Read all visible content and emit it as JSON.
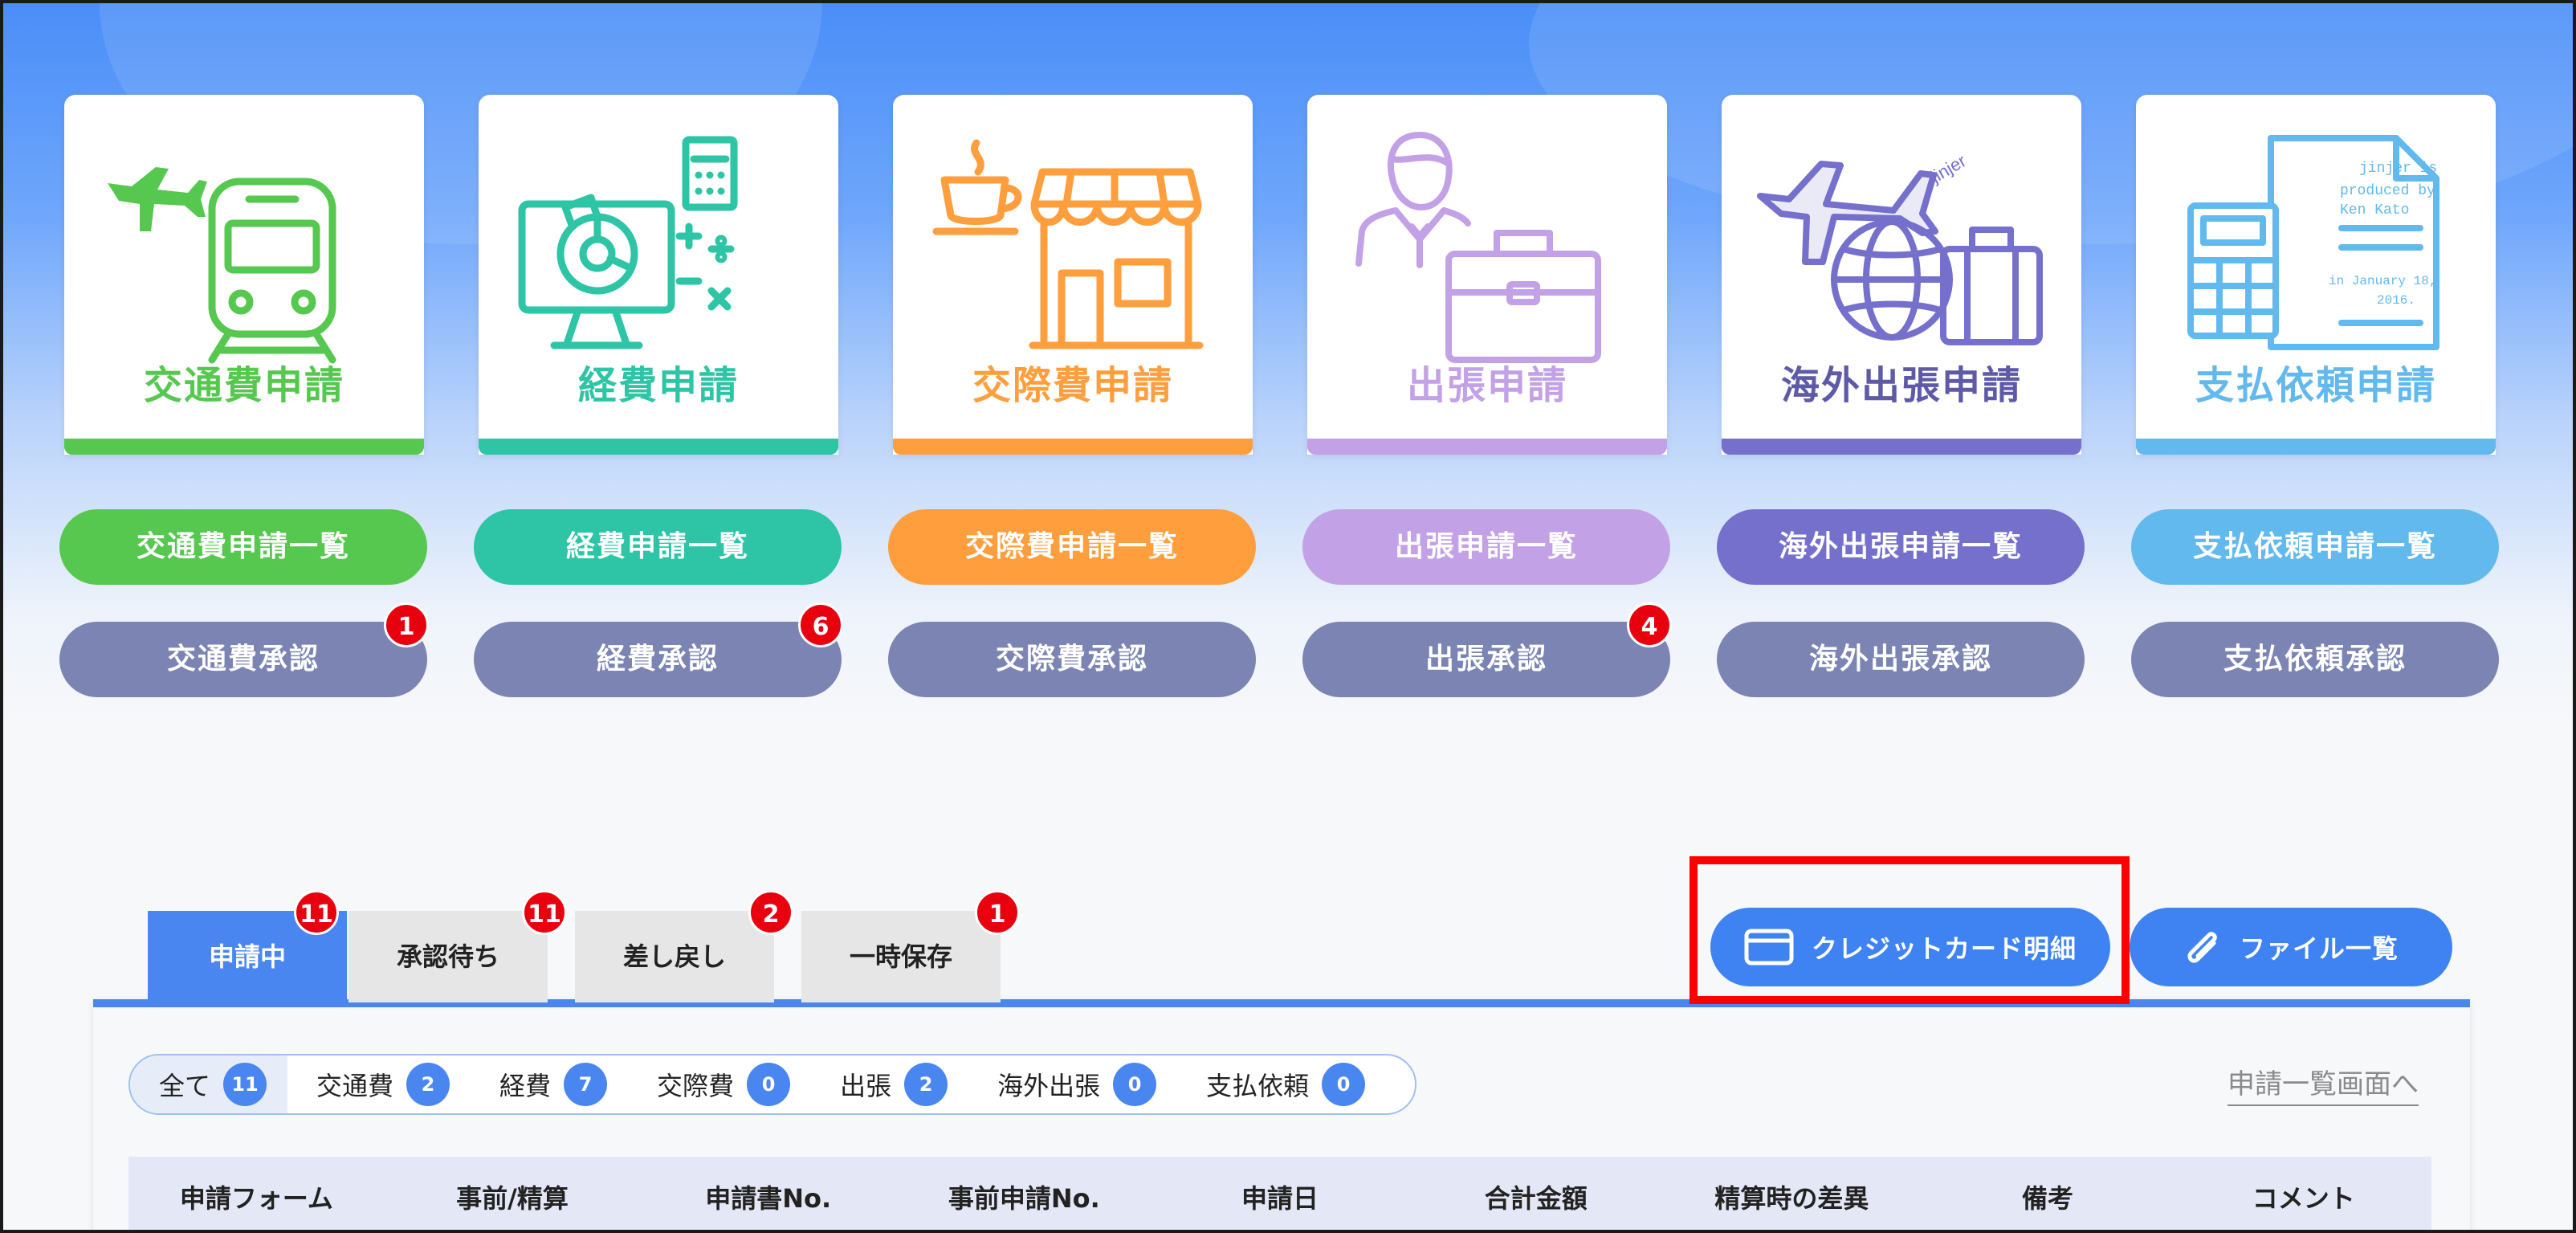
{
  "colors": {
    "transport": "#56c84f",
    "expense": "#2ec4a6",
    "entertainment": "#ff9e3d",
    "trip": "#c3a1e6",
    "overseas": "#7570cc",
    "payment": "#62b9ee",
    "approve": "#7b84b2",
    "accent": "#4a86f0",
    "badge": "#e8000f",
    "highlight": "#ff0000"
  },
  "tiles": [
    {
      "label": "交通費申請",
      "icon": "train-plane-icon"
    },
    {
      "label": "経費申請",
      "icon": "monitor-calculator-icon"
    },
    {
      "label": "交際費申請",
      "icon": "coffee-shop-icon"
    },
    {
      "label": "出張申請",
      "icon": "businessman-briefcase-icon"
    },
    {
      "label": "海外出張申請",
      "icon": "plane-globe-suitcase-icon"
    },
    {
      "label": "支払依頼申請",
      "icon": "calculator-document-icon"
    }
  ],
  "list_buttons": [
    "交通費申請一覧",
    "経費申請一覧",
    "交際費申請一覧",
    "出張申請一覧",
    "海外出張申請一覧",
    "支払依頼申請一覧"
  ],
  "approve_buttons": [
    {
      "label": "交通費承認",
      "badge": "1"
    },
    {
      "label": "経費承認",
      "badge": "6"
    },
    {
      "label": "交際費承認",
      "badge": ""
    },
    {
      "label": "出張承認",
      "badge": "4"
    },
    {
      "label": "海外出張承認",
      "badge": ""
    },
    {
      "label": "支払依頼承認",
      "badge": ""
    }
  ],
  "tabs": [
    {
      "label": "申請中",
      "badge": "11"
    },
    {
      "label": "承認待ち",
      "badge": "11"
    },
    {
      "label": "差し戻し",
      "badge": "2"
    },
    {
      "label": "一時保存",
      "badge": "1"
    }
  ],
  "actions": {
    "credit_card": "クレジットカード明細",
    "file_list": "ファイル一覧"
  },
  "filters": [
    {
      "label": "全て",
      "count": "11"
    },
    {
      "label": "交通費",
      "count": "2"
    },
    {
      "label": "経費",
      "count": "7"
    },
    {
      "label": "交際費",
      "count": "0"
    },
    {
      "label": "出張",
      "count": "2"
    },
    {
      "label": "海外出張",
      "count": "0"
    },
    {
      "label": "支払依頼",
      "count": "0"
    }
  ],
  "back_link": "申請一覧画面へ",
  "table": {
    "headers": [
      "申請フォーム",
      "事前/精算",
      "申請書No.",
      "事前申請No.",
      "申請日",
      "合計金額",
      "精算時の差異",
      "備考",
      "コメント"
    ]
  },
  "doc_text": [
    "jinjer is",
    "produced by",
    "Ken Kato",
    "in January 18,",
    "2016."
  ]
}
